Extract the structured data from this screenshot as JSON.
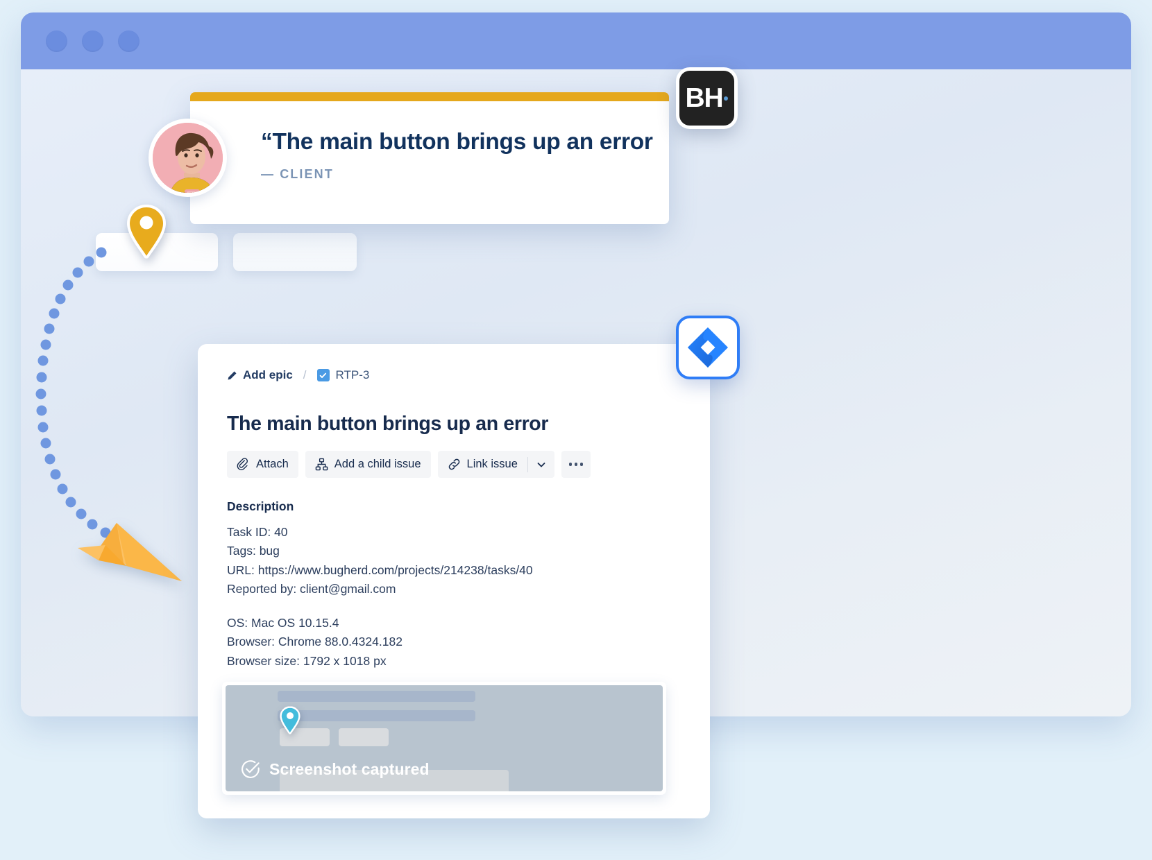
{
  "browser": {
    "traffic_lights": [
      "close",
      "minimize",
      "maximize"
    ]
  },
  "quote_card": {
    "quote": "“The main button brings up an error",
    "attribution": "— CLIENT",
    "accent_color": "#e5a81c",
    "avatar_alt": "client-avatar"
  },
  "badges": {
    "bugherd": {
      "label": "BH",
      "background": "#222222",
      "dot_color": "#5b9bd5"
    },
    "jira": {
      "label": "Jira",
      "border_color": "#2f7df6",
      "logo_color": "#2684ff"
    }
  },
  "issue_card": {
    "breadcrumb": {
      "epic_label": "Add epic",
      "separator": "/",
      "task_key": "RTP-3"
    },
    "title": "The main button brings up an error",
    "toolbar": {
      "attach_label": "Attach",
      "child_issue_label": "Add a child issue",
      "link_issue_label": "Link issue"
    },
    "description": {
      "heading": "Description",
      "lines_group_1": [
        "Task ID: 40",
        "Tags: bug",
        "URL: https://www.bugherd.com/projects/214238/tasks/40",
        "Reported by: client@gmail.com"
      ],
      "lines_group_2": [
        "OS: Mac OS 10.15.4",
        "Browser: Chrome 88.0.4324.182",
        "Browser size: 1792 x 1018 px"
      ]
    },
    "screenshot": {
      "caption": "Screenshot captured",
      "pin_color": "#42bcdc"
    }
  },
  "decorations": {
    "trail_dot_color": "#6f97e0",
    "pin_marker_color": "#e8ab1d",
    "paper_plane_color": "#f9b44c",
    "page_background": "#e2f0f9"
  }
}
